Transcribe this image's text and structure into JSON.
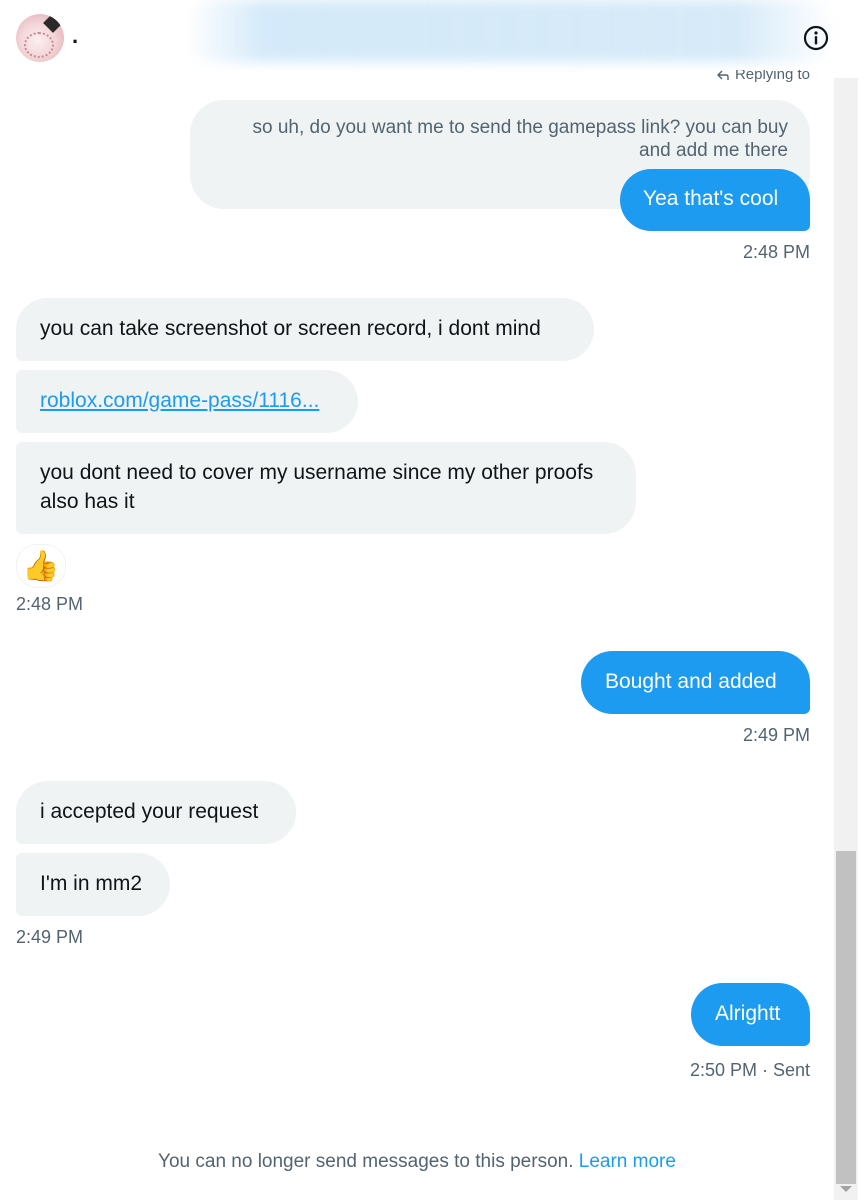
{
  "header": {
    "username": ".",
    "info_icon": "info-circle-icon"
  },
  "conversation": {
    "replying_to": "Replying to",
    "quoted_text": "so uh, do you want me to send the gamepass link? you can buy and add me there",
    "messages": [
      {
        "dir": "out",
        "text": "Yea that's cool"
      },
      {
        "dir": "in",
        "text": "you can take screenshot or screen record, i dont mind"
      },
      {
        "dir": "in",
        "text": "roblox.com/game-pass/1116..."
      },
      {
        "dir": "in",
        "text": "you dont need to cover my username since my other proofs also has it"
      },
      {
        "dir": "out",
        "text": "Bought and added"
      },
      {
        "dir": "in",
        "text": "i accepted your request"
      },
      {
        "dir": "in",
        "text": "I'm in mm2"
      },
      {
        "dir": "out",
        "text": "Alrightt"
      }
    ],
    "timestamps": {
      "t1": "2:48 PM",
      "t2": "2:48 PM",
      "t3": "2:49 PM",
      "t4": "2:49 PM",
      "t5": "2:50 PM · Sent"
    },
    "reaction": "👍"
  },
  "footer": {
    "note": "You can no longer send messages to this person.",
    "link": "Learn more"
  },
  "colors": {
    "accent": "#1d9bf0",
    "bubble_in": "#eff3f4",
    "muted_text": "#536471"
  }
}
